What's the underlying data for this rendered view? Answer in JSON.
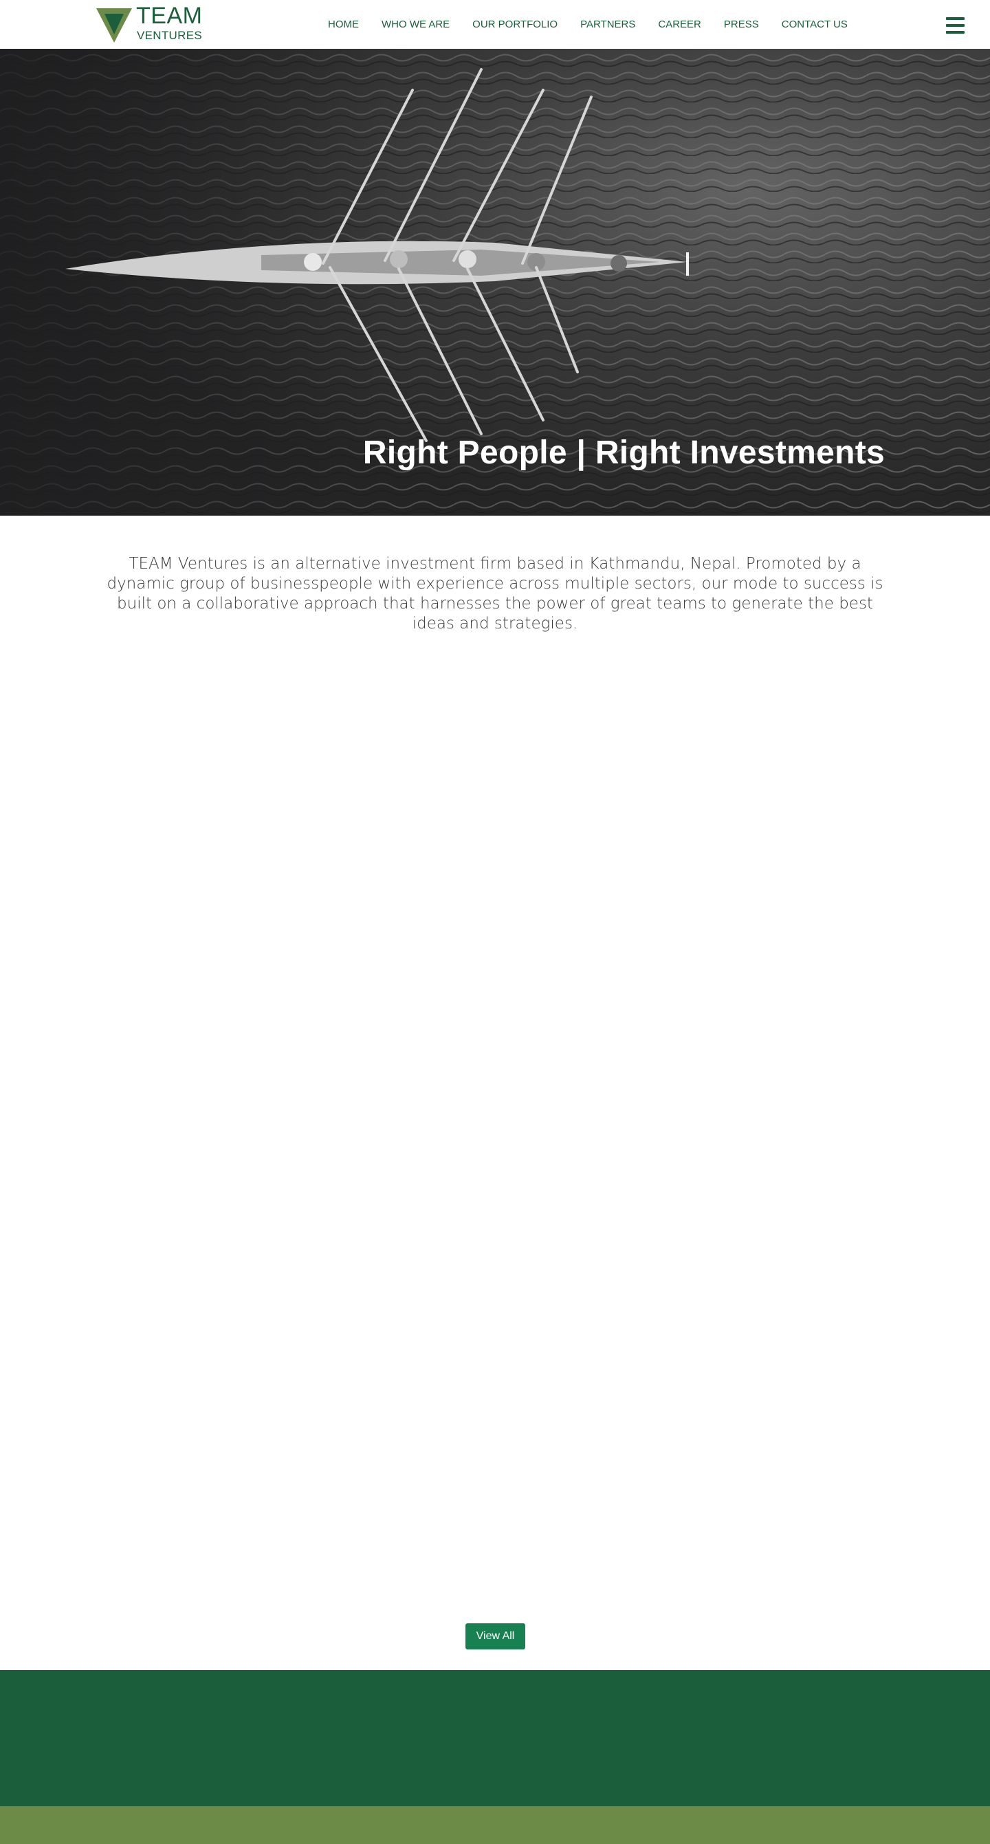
{
  "brand": {
    "name_top": "TEAM",
    "name_bottom": "VENTURES",
    "primary_color": "#1b5e3b",
    "secondary_color": "#6c8b46",
    "button_color": "#178152"
  },
  "nav": {
    "items": [
      {
        "label": "HOME"
      },
      {
        "label": "WHO WE ARE"
      },
      {
        "label": "OUR PORTFOLIO"
      },
      {
        "label": "PARTNERS"
      },
      {
        "label": "CAREER"
      },
      {
        "label": "PRESS"
      },
      {
        "label": "CONTACT US"
      }
    ],
    "menu_icon": "hamburger-menu-icon"
  },
  "hero": {
    "title": "Right People | Right Investments",
    "image": "aerial view of rowing team on water"
  },
  "intro": {
    "text": "TEAM Ventures is an alternative investment firm based in Kathmandu, Nepal. Promoted by a dynamic group of businesspeople with experience across multiple sectors, our mode to success is built on a collaborative approach that harnesses the power of great teams to generate the best ideas and strategies."
  },
  "portfolio": {
    "view_all_label": "View All"
  }
}
